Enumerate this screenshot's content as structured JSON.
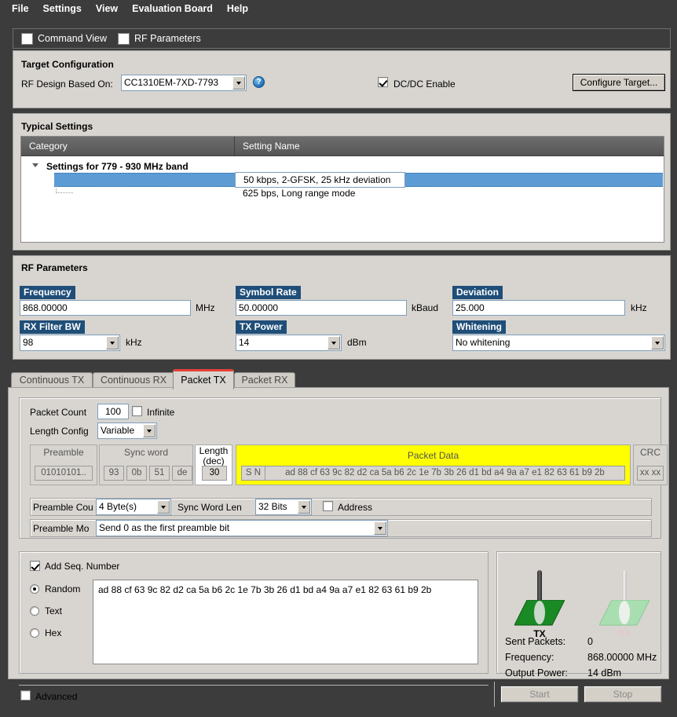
{
  "menu": {
    "items": [
      "File",
      "Settings",
      "View",
      "Evaluation Board",
      "Help"
    ]
  },
  "toolbar": {
    "items": [
      {
        "label": "Command View"
      },
      {
        "label": "RF Parameters"
      }
    ]
  },
  "target_configuration": {
    "title": "Target Configuration",
    "design_label": "RF Design Based On:",
    "design_value": "CC1310EM-7XD-7793",
    "help_glyph": "?",
    "dcdc_label": "DC/DC Enable",
    "dcdc_checked": true,
    "configure_button": "Configure Target..."
  },
  "typical_settings": {
    "title": "Typical Settings",
    "columns": [
      "Category",
      "Setting Name"
    ],
    "group": "Settings for 779 - 930 MHz band",
    "rows": [
      {
        "name": "50 kbps, 2-GFSK, 25 kHz deviation",
        "selected": true
      },
      {
        "name": "625 bps, Long range mode",
        "selected": false
      }
    ]
  },
  "rf_parameters": {
    "title": "RF Parameters",
    "frequency": {
      "label": "Frequency",
      "value": "868.00000",
      "unit": "MHz"
    },
    "symbol_rate": {
      "label": "Symbol Rate",
      "value": "50.00000",
      "unit": "kBaud"
    },
    "deviation": {
      "label": "Deviation",
      "value": "25.000",
      "unit": "kHz"
    },
    "rx_filter_bw": {
      "label": "RX Filter BW",
      "value": "98",
      "unit": "kHz"
    },
    "tx_power": {
      "label": "TX Power",
      "value": "14",
      "unit": "dBm"
    },
    "whitening": {
      "label": "Whitening",
      "value": "No whitening"
    }
  },
  "tabs": [
    {
      "label": "Continuous TX",
      "active": false
    },
    {
      "label": "Continuous RX",
      "active": false
    },
    {
      "label": "Packet TX",
      "active": true
    },
    {
      "label": "Packet RX",
      "active": false
    }
  ],
  "packet_tx": {
    "packet_count_label": "Packet Count",
    "packet_count_value": "100",
    "infinite_label": "Infinite",
    "infinite_checked": false,
    "length_config_label": "Length Config",
    "length_config_value": "Variable",
    "structure": {
      "preamble_caption": "Preamble",
      "preamble_value": "01010101..",
      "sync_caption": "Sync word",
      "sync_bytes": [
        "93",
        "0b",
        "51",
        "de"
      ],
      "length_caption_line1": "Length",
      "length_caption_line2": "(dec)",
      "length_value": "30",
      "data_caption": "Packet Data",
      "seq_cell": "S N",
      "data_value": "ad 88 cf 63 9c 82 d2 ca 5a b6 2c 1e 7b 3b 26 d1 bd a4 9a a7 e1 82 63 61 b9 2b",
      "crc_caption": "CRC",
      "crc_value": "xx xx"
    },
    "preamble_count_label": "Preamble Cou",
    "preamble_count_value": "4 Byte(s)",
    "sync_word_len_label": "Sync Word Len",
    "sync_word_len_value": "32 Bits",
    "address_label": "Address",
    "address_checked": false,
    "preamble_mode_label": "Preamble Mo",
    "preamble_mode_value": "Send 0 as the first preamble bit",
    "add_seq_label": "Add Seq. Number",
    "add_seq_checked": true,
    "payload_modes": [
      {
        "label": "Random",
        "selected": true
      },
      {
        "label": "Text",
        "selected": false
      },
      {
        "label": "Hex",
        "selected": false
      }
    ],
    "payload_text": "ad 88 cf 63 9c 82 d2 ca 5a b6 2c 1e 7b 3b 26 d1 bd a4 9a a7 e1 82 63 61 b9 2b"
  },
  "status": {
    "tx_label": "TX",
    "rx_label": "RX",
    "tx_active": true,
    "rx_active": false,
    "rows": [
      {
        "label": "Sent Packets:",
        "value": "0"
      },
      {
        "label": "Frequency:",
        "value": "868.00000 MHz"
      },
      {
        "label": "Output Power:",
        "value": "14 dBm"
      }
    ]
  },
  "footer": {
    "advanced_label": "Advanced",
    "advanced_checked": false,
    "start_label": "Start",
    "stop_label": "Stop"
  },
  "colors": {
    "accent_blue": "#1f4e79",
    "selection": "#5d9bd5",
    "packet_data": "#ffff00",
    "active_tab_border": "#e8403a",
    "tx_green": "#1a8a24"
  }
}
